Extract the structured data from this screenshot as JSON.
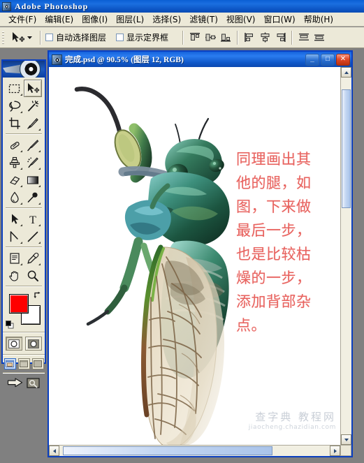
{
  "app": {
    "title": "Adobe Photoshop",
    "icon": "photoshop-icon"
  },
  "menubar": {
    "items": [
      {
        "label": "文件(F)",
        "name": "menu-file"
      },
      {
        "label": "编辑(E)",
        "name": "menu-edit"
      },
      {
        "label": "图像(I)",
        "name": "menu-image"
      },
      {
        "label": "图层(L)",
        "name": "menu-layer"
      },
      {
        "label": "选择(S)",
        "name": "menu-select"
      },
      {
        "label": "滤镜(T)",
        "name": "menu-filter"
      },
      {
        "label": "视图(V)",
        "name": "menu-view"
      },
      {
        "label": "窗口(W)",
        "name": "menu-window"
      },
      {
        "label": "帮助(H)",
        "name": "menu-help"
      }
    ]
  },
  "options_bar": {
    "active_tool": "move-tool",
    "auto_select_layer": {
      "label": "自动选择图层",
      "checked": false
    },
    "show_bounding_box": {
      "label": "显示定界框",
      "checked": false
    },
    "align_buttons": [
      "align-top-edges",
      "align-vertical-centers",
      "align-bottom-edges",
      "align-left-edges",
      "align-horizontal-centers",
      "align-right-edges",
      "distribute-top-edges",
      "distribute-vertical-centers"
    ]
  },
  "toolbox": {
    "tools": [
      {
        "name": "rectangular-marquee-tool",
        "selected": false,
        "has_flyout": true
      },
      {
        "name": "move-tool",
        "selected": true,
        "has_flyout": false
      },
      {
        "name": "lasso-tool",
        "selected": false,
        "has_flyout": true
      },
      {
        "name": "magic-wand-tool",
        "selected": false,
        "has_flyout": false
      },
      {
        "name": "crop-tool",
        "selected": false,
        "has_flyout": false
      },
      {
        "name": "slice-tool",
        "selected": false,
        "has_flyout": true
      },
      {
        "name": "healing-brush-tool",
        "selected": false,
        "has_flyout": true
      },
      {
        "name": "brush-tool",
        "selected": false,
        "has_flyout": true
      },
      {
        "name": "clone-stamp-tool",
        "selected": false,
        "has_flyout": true
      },
      {
        "name": "history-brush-tool",
        "selected": false,
        "has_flyout": true
      },
      {
        "name": "eraser-tool",
        "selected": false,
        "has_flyout": true
      },
      {
        "name": "gradient-tool",
        "selected": false,
        "has_flyout": true
      },
      {
        "name": "blur-tool",
        "selected": false,
        "has_flyout": true
      },
      {
        "name": "dodge-tool",
        "selected": false,
        "has_flyout": true
      },
      {
        "name": "path-selection-tool",
        "selected": false,
        "has_flyout": true
      },
      {
        "name": "type-tool",
        "selected": false,
        "has_flyout": true
      },
      {
        "name": "pen-tool",
        "selected": false,
        "has_flyout": true
      },
      {
        "name": "line-tool",
        "selected": false,
        "has_flyout": true
      },
      {
        "name": "notes-tool",
        "selected": false,
        "has_flyout": true
      },
      {
        "name": "eyedropper-tool",
        "selected": false,
        "has_flyout": true
      },
      {
        "name": "hand-tool",
        "selected": false,
        "has_flyout": false
      },
      {
        "name": "zoom-tool",
        "selected": false,
        "has_flyout": false
      }
    ],
    "colors": {
      "foreground": "#ff0000",
      "background": "#ffffff"
    },
    "mask_modes": [
      "standard-mode",
      "quick-mask-mode"
    ],
    "screen_modes": [
      "standard-screen-mode",
      "full-screen-with-menubar",
      "full-screen-mode"
    ],
    "jump_buttons": [
      "jump-to-imageready",
      "jump-preview"
    ]
  },
  "document": {
    "title": "完成.psd @ 90.5%  (图层 12, RGB)",
    "filename": "完成.psd",
    "zoom": "90.5%",
    "layer": "图层 12",
    "color_mode": "RGB",
    "window_buttons": {
      "minimize": "_",
      "maximize": "□",
      "close": "✕"
    }
  },
  "canvas": {
    "annotation_text": "同理画出其他的腿，如图，下来做最后一步，也是比较枯燥的一步，添加背部杂点。",
    "annotation_color": "#e8635f",
    "artwork_subject": "cicada-illustration"
  },
  "watermark": {
    "site_name": "查字典 教程网",
    "url": "jiaocheng.chazidian.com"
  }
}
